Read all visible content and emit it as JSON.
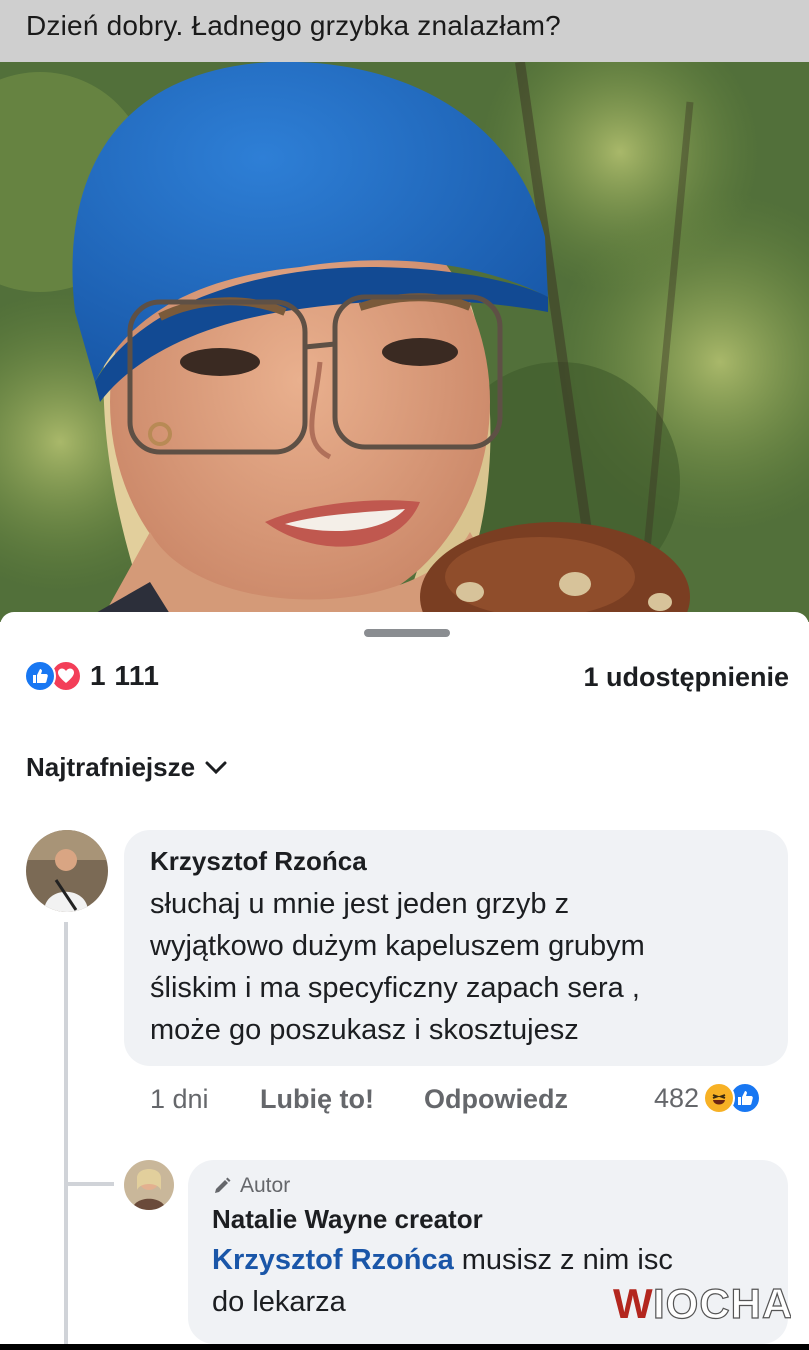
{
  "caption": "Dzień dobry. Ładnego grzybka znalazłam?",
  "post": {
    "reaction_count": "1 111",
    "shares": "1 udostępnienie",
    "sort_label": "Najtrafniejsze",
    "reaction_icons": [
      "like-icon",
      "love-icon"
    ]
  },
  "comments": [
    {
      "author": "Krzysztof Rzońca",
      "lines": [
        "słuchaj u mnie jest jeden grzyb z",
        "wyjątkowo dużym kapeluszem grubym",
        "śliskim i ma specyficzny zapach sera ,",
        "może go poszukasz i skosztujesz"
      ],
      "time": "1 dni",
      "like_label": "Lubię to!",
      "reply_label": "Odpowiedz",
      "reaction_count": "482",
      "reaction_icons": [
        "haha-icon",
        "like-icon"
      ]
    }
  ],
  "reply": {
    "badge": "Autor",
    "author": "Natalie Wayne creator",
    "mention": "Krzysztof Rzońca",
    "text_line1": " musisz z nim isc",
    "text_line2": "do lekarza"
  },
  "watermark": "WIOCHA",
  "colors": {
    "like": "#1877f2",
    "love": "#f33e58",
    "haha": "#f7b125",
    "mention": "#1a56a8",
    "bubble": "#f0f2f5",
    "caption_bg": "#cfcfcf",
    "watermark": "#b3261e"
  }
}
